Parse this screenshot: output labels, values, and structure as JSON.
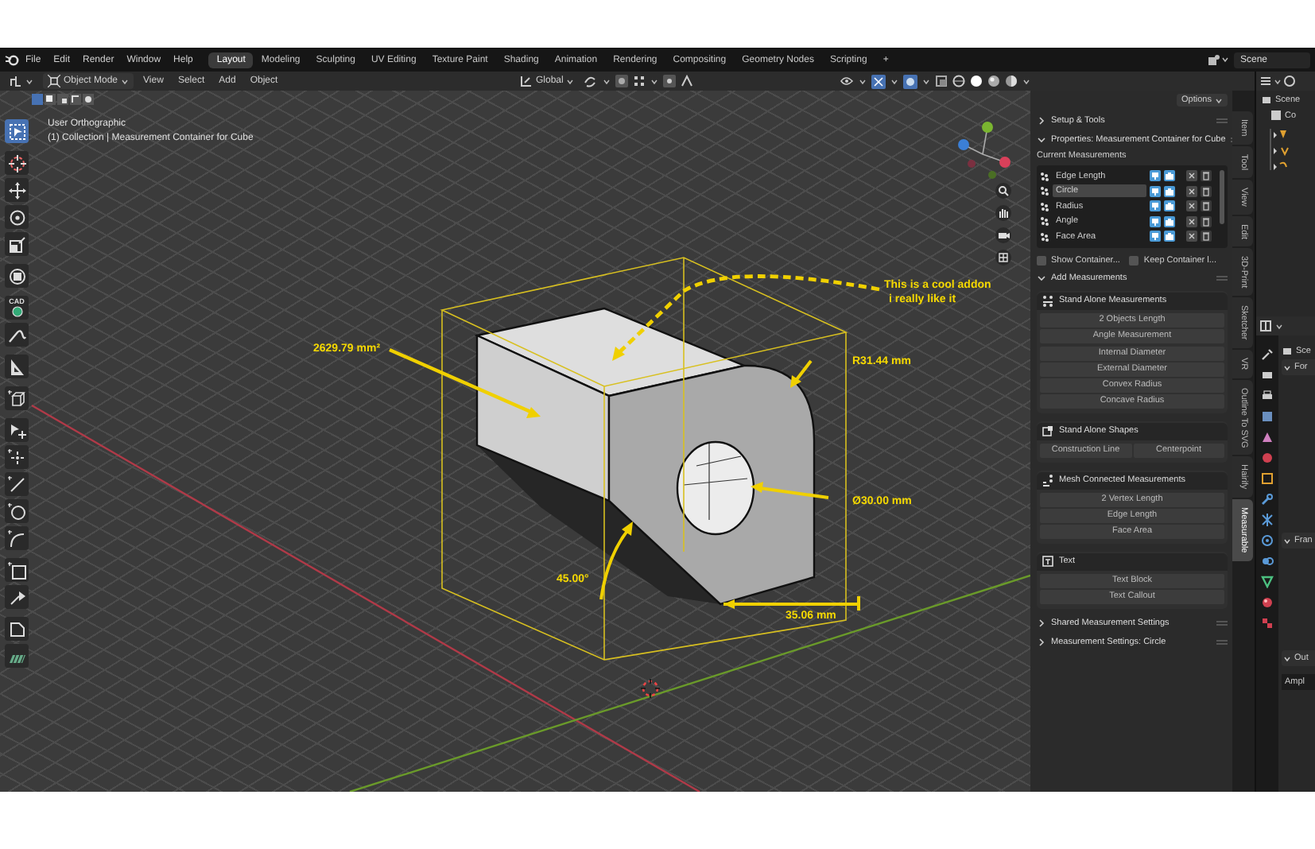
{
  "topbar": {
    "menus": [
      "File",
      "Edit",
      "Render",
      "Window",
      "Help"
    ],
    "workspaces": [
      {
        "label": "Layout",
        "selected": true
      },
      {
        "label": "Modeling",
        "selected": false
      },
      {
        "label": "Sculpting",
        "selected": false
      },
      {
        "label": "UV Editing",
        "selected": false
      },
      {
        "label": "Texture Paint",
        "selected": false
      },
      {
        "label": "Shading",
        "selected": false
      },
      {
        "label": "Animation",
        "selected": false
      },
      {
        "label": "Rendering",
        "selected": false
      },
      {
        "label": "Compositing",
        "selected": false
      },
      {
        "label": "Geometry Nodes",
        "selected": false
      },
      {
        "label": "Scripting",
        "selected": false
      }
    ],
    "add_workspace": "+",
    "scene": "Scene"
  },
  "header": {
    "mode": "Object Mode",
    "menus": [
      "View",
      "Select",
      "Add",
      "Object"
    ],
    "orientation": "Global"
  },
  "viewport": {
    "view_name": "User Orthographic",
    "object_info": "(1) Collection | Measurement Container for Cube",
    "tools": [
      {
        "kind": "select",
        "selected": true
      },
      {
        "kind": "cursor",
        "selected": false
      },
      {
        "kind": "move",
        "selected": false
      },
      {
        "kind": "rotate",
        "selected": false
      },
      {
        "kind": "scale",
        "selected": false
      },
      {
        "kind": "transform",
        "selected": false
      },
      {
        "kind": "cad",
        "label": "CAD",
        "selected": false
      },
      {
        "kind": "annotate",
        "selected": false
      },
      {
        "kind": "measure",
        "selected": false
      },
      {
        "kind": "add-cube",
        "selected": false
      },
      {
        "kind": "select-add",
        "selected": false
      },
      {
        "kind": "vertex",
        "selected": false
      },
      {
        "kind": "line",
        "selected": false
      },
      {
        "kind": "circle",
        "selected": false
      },
      {
        "kind": "arc",
        "selected": false
      },
      {
        "kind": "rectangle",
        "selected": false
      },
      {
        "kind": "extend",
        "selected": false
      },
      {
        "kind": "shape",
        "selected": false
      },
      {
        "kind": "hatch",
        "selected": false
      }
    ],
    "annotations": [
      {
        "kind": "area",
        "text": "2629.79 mm²"
      },
      {
        "kind": "radius",
        "text": "R31.44 mm"
      },
      {
        "kind": "diameter",
        "text": "Ø30.00 mm"
      },
      {
        "kind": "angle",
        "text": "45.00°"
      },
      {
        "kind": "length",
        "text": "35.06 mm"
      },
      {
        "kind": "callout",
        "lines": [
          "This is a cool addon",
          "i really like it"
        ]
      }
    ]
  },
  "sidebar": {
    "options": "Options",
    "setup_panel": {
      "title": "Setup & Tools",
      "expanded": false
    },
    "properties_panel": {
      "title": "Properties: Measurement Container for Cube",
      "expanded": true,
      "list_title": "Current Measurements",
      "measurements": [
        {
          "name": "Edge Length",
          "selected": false
        },
        {
          "name": "Circle",
          "selected": true
        },
        {
          "name": "Radius",
          "selected": false
        },
        {
          "name": "Angle",
          "selected": false
        },
        {
          "name": "Face Area",
          "selected": false
        }
      ],
      "checkboxes": [
        {
          "label": "Show Container...",
          "checked": false
        },
        {
          "label": "Keep Container l...",
          "checked": false
        }
      ]
    },
    "add_panel": {
      "title": "Add Measurements",
      "expanded": true,
      "groups": [
        {
          "kind": "standalone",
          "title": "Stand Alone Measurements",
          "blocks": [
            [
              [
                "2 Objects Length"
              ],
              [
                "Angle Measurement"
              ]
            ],
            [
              [
                "Internal Diameter"
              ],
              [
                "External Diameter"
              ],
              [
                "Convex Radius"
              ],
              [
                "Concave Radius"
              ]
            ]
          ]
        },
        {
          "kind": "shapes",
          "title": "Stand Alone Shapes",
          "blocks": [
            [
              [
                "Construction Line",
                "Centerpoint"
              ]
            ]
          ]
        },
        {
          "kind": "mesh",
          "title": "Mesh Connected Measurements",
          "blocks": [
            [
              [
                "2 Vertex Length"
              ],
              [
                "Edge Length"
              ],
              [
                "Face Area"
              ]
            ]
          ]
        },
        {
          "kind": "text",
          "title": "Text",
          "blocks": [
            [
              [
                "Text Block"
              ],
              [
                "Text Callout"
              ]
            ]
          ]
        }
      ]
    },
    "closed_panels": [
      {
        "title": "Shared Measurement Settings",
        "expanded": false
      },
      {
        "title": "Measurement Settings: Circle",
        "expanded": false
      }
    ],
    "tabs": [
      {
        "label": "Item",
        "selected": false
      },
      {
        "label": "Tool",
        "selected": false
      },
      {
        "label": "View",
        "selected": false
      },
      {
        "label": "Edit",
        "selected": false
      },
      {
        "label": "3D-Print",
        "selected": false
      },
      {
        "label": "Sketcher",
        "selected": false
      },
      {
        "label": "VR",
        "selected": false
      },
      {
        "label": "Outline To SVG",
        "selected": false
      },
      {
        "label": "Hairify",
        "selected": false
      },
      {
        "label": "Measurable",
        "selected": true
      }
    ]
  },
  "outliner": {
    "rows": [
      "Scene",
      "Co"
    ]
  },
  "properties_editor": {
    "context": "Sce",
    "panels": [
      {
        "title": "For",
        "expanded": true
      },
      {
        "title": "Fran",
        "expanded": true
      },
      {
        "title": "Out",
        "expanded": true
      }
    ],
    "field": "Ampl"
  }
}
